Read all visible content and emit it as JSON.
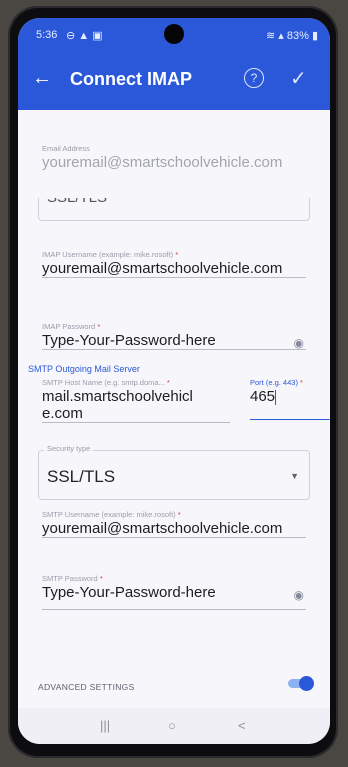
{
  "status_bar": {
    "time": "5:36",
    "left_icons": "⊖ ▲ ▣",
    "battery": "83%"
  },
  "app_bar": {
    "title": "Connect IMAP",
    "back_icon": "←",
    "help_icon": "?",
    "confirm_icon": "✓"
  },
  "form": {
    "email": {
      "label": "Email Address",
      "value": "youremail@smartschoolvehicle.com"
    },
    "incoming_security_partial": "SSL/TLS",
    "imap_username": {
      "label": "IMAP Username (example: mike.rosoft)",
      "required_mark": "*",
      "value": "youremail@smartschoolvehicle.com"
    },
    "imap_password": {
      "label": "IMAP Password",
      "required_mark": "*",
      "value": "Type-Your-Password-here"
    },
    "smtp_section_title": "SMTP Outgoing Mail Server",
    "smtp_host": {
      "label": "SMTP Host Name (e.g. smtp.doma...",
      "required_mark": "*",
      "value": "mail.smartschoolvehicle.com"
    },
    "smtp_port": {
      "label": "Port (e.g. 443)",
      "required_mark": "*",
      "value": "465"
    },
    "security_type": {
      "label": "Security type",
      "value": "SSL/TLS"
    },
    "smtp_username": {
      "label": "SMTP Username (example: mike.rosoft)",
      "required_mark": "*",
      "value": "youremail@smartschoolvehicle.com"
    },
    "smtp_password": {
      "label": "SMTP Password",
      "required_mark": "*",
      "value": "Type-Your-Password-here"
    },
    "advanced_settings": {
      "label": "ADVANCED SETTINGS",
      "enabled": true
    }
  },
  "nav_bar": {
    "recents": "|||",
    "home": "○",
    "back": "<"
  },
  "colors": {
    "accent": "#2a58d9",
    "background": "#f7f7fb",
    "required": "#d23c3c"
  }
}
